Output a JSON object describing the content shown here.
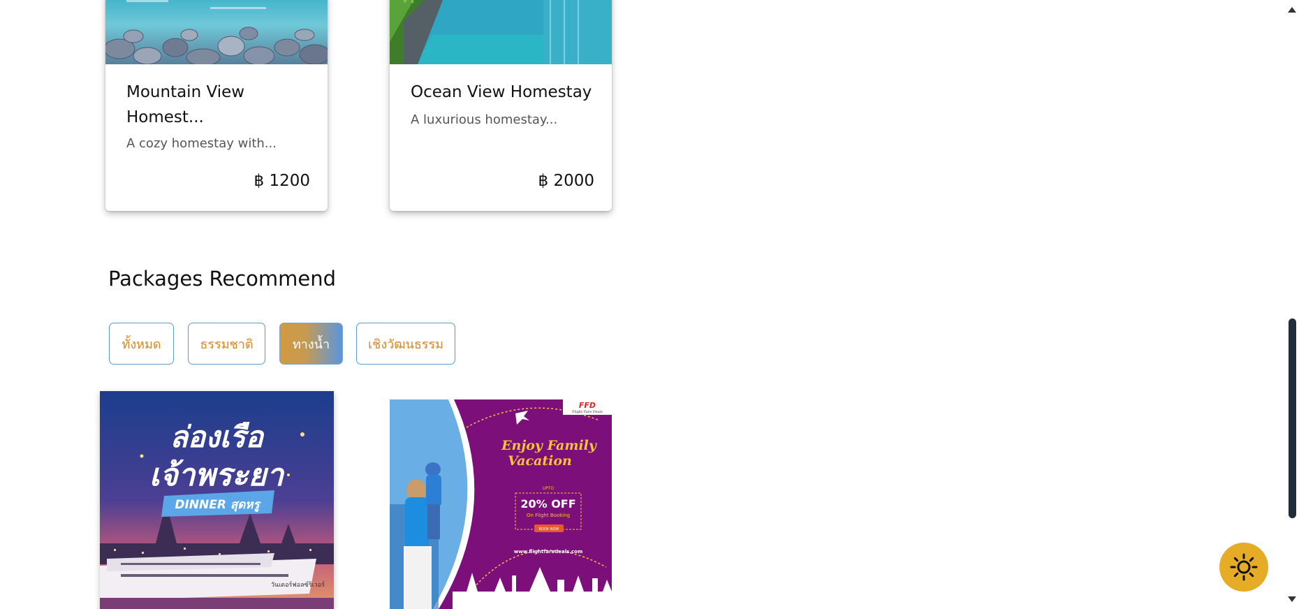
{
  "homestays": [
    {
      "title_line1": "Mountain View",
      "title_line2": "Homest...",
      "description": "A cozy homestay with...",
      "price": "฿ 1200"
    },
    {
      "title_line1": "Ocean View Homestay",
      "title_line2": "",
      "description": "A luxurious homestay...",
      "price": "฿ 2000"
    }
  ],
  "packages_section": {
    "title": "Packages Recommend",
    "filters": [
      {
        "label": "ทั้งหมด",
        "active": false
      },
      {
        "label": "ธรรมชาติ",
        "active": false
      },
      {
        "label": "ทางน้ำ",
        "active": true
      },
      {
        "label": "เชิงวัฒนธรรม",
        "active": false
      }
    ]
  },
  "packages": [
    {
      "title_line1": "ล่องเรือ",
      "title_line2": "เจ้าพระยา",
      "banner": "DINNER สุดหรู",
      "boat_text": "วันเดอร์ฟอลซ์ริเวอร์"
    },
    {
      "logo": "FFD",
      "logo_sub": "Flight Fare Deals",
      "headline_line1": "Enjoy Family",
      "headline_line2": "Vacation",
      "upto": "UPTO",
      "discount": "20% OFF",
      "discount_sub": "On Flight Booking",
      "cta": "BOOK NOW",
      "url": "www.flightfaredeals.com"
    }
  ],
  "theme_toggle": {
    "icon": "sun-icon",
    "color": "#e6ac25"
  }
}
